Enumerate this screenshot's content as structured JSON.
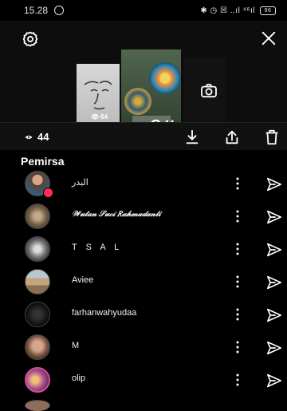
{
  "status_bar": {
    "time": "15.28",
    "indicators": "✱ ◷ ☒ ..ıl ⁴⁶ıl",
    "battery": "96"
  },
  "stories": [
    {
      "view_count": "64"
    },
    {
      "view_count": "44",
      "selected": true
    },
    {
      "type": "camera",
      "icon": "camera-icon"
    }
  ],
  "stats": {
    "view_count": "44",
    "actions": [
      {
        "name": "download",
        "icon": "download-icon"
      },
      {
        "name": "share",
        "icon": "share-icon"
      },
      {
        "name": "delete",
        "icon": "trash-icon"
      }
    ]
  },
  "viewers_title": "Pemirsa",
  "viewers": [
    {
      "name": "البدر",
      "liked": true,
      "avatar_color": "#3a5b77",
      "style": "normal"
    },
    {
      "name": "𝒲𝓊𝓉𝒶𝓃 𝒮𝓊𝒸𝒾 𝑅𝒶𝒽𝓂𝒶𝒹𝒶𝓃𝓉𝒾",
      "liked": false,
      "avatar_color": "#8f7a62",
      "style": "script"
    },
    {
      "name": "T S A L",
      "liked": false,
      "avatar_color": "#7a7a7a",
      "style": "tsal"
    },
    {
      "name": "Aviee",
      "liked": false,
      "avatar_color": "#9c8d63",
      "style": "normal"
    },
    {
      "name": "farhanwahyudaa",
      "liked": false,
      "avatar_color": "#111111",
      "style": "normal"
    },
    {
      "name": "M",
      "liked": false,
      "avatar_color": "#8a6d5a",
      "style": "normal"
    },
    {
      "name": "olip",
      "liked": false,
      "avatar_color": "#b0568b",
      "style": "normal"
    }
  ],
  "colors": {
    "background": "#000000",
    "panel": "#0d0d0d",
    "heart": "#ff2d55",
    "text": "#ffffff"
  }
}
